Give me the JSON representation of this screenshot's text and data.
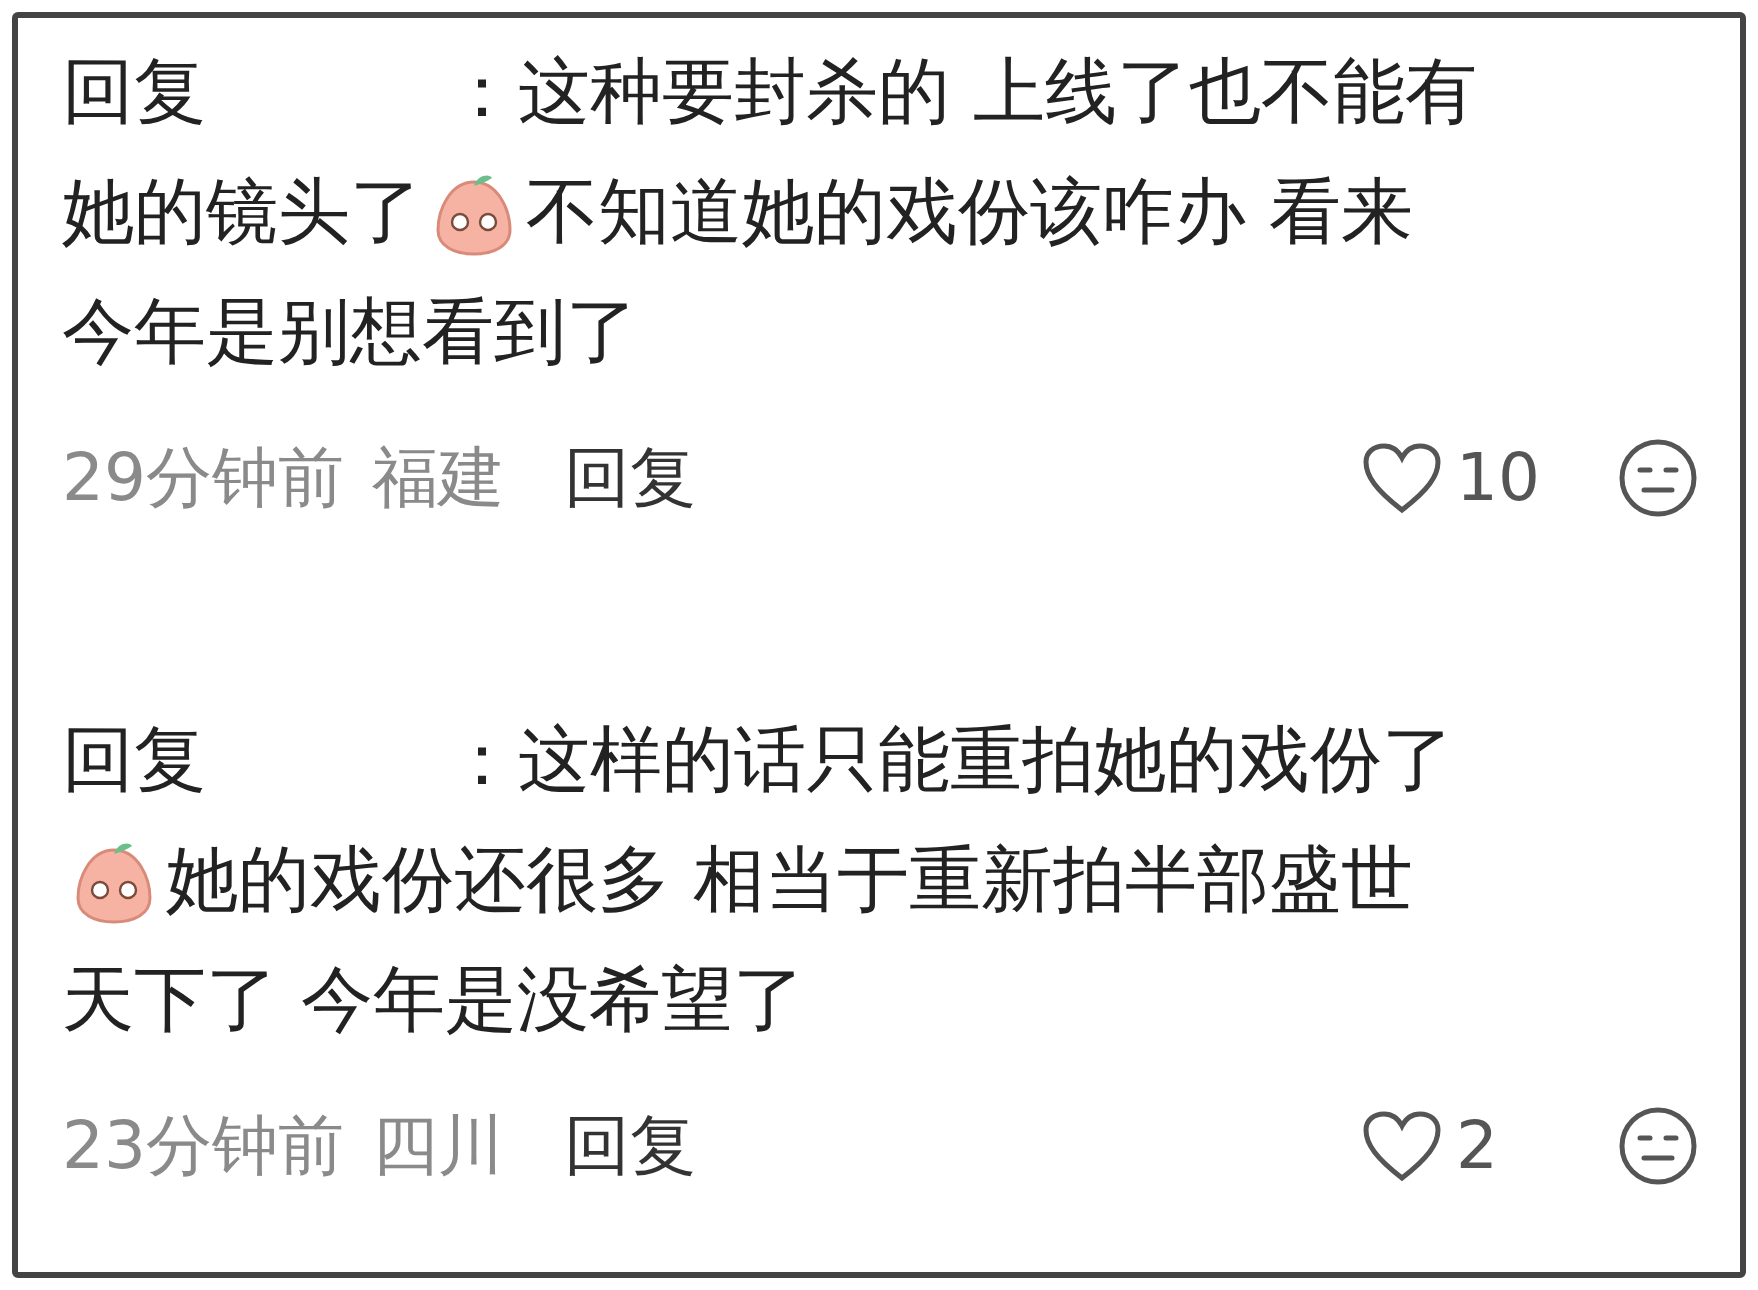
{
  "comments": [
    {
      "lines": [
        [
          {
            "kind": "label",
            "text": "回复"
          },
          {
            "kind": "text",
            "text": "：这种要封杀的 上线了也不能有"
          }
        ],
        [
          {
            "kind": "text",
            "text": "她的镜头了"
          },
          {
            "kind": "emoji"
          },
          {
            "kind": "text",
            "text": "不知道她的戏份该咋办 看来"
          }
        ],
        [
          {
            "kind": "text",
            "text": "今年是别想看到了"
          }
        ]
      ],
      "time": "29分钟前",
      "location": "福建",
      "reply_button": "回复",
      "likes": "10"
    },
    {
      "lines": [
        [
          {
            "kind": "label",
            "text": "回复"
          },
          {
            "kind": "text",
            "text": "：这样的话只能重拍她的戏份了"
          }
        ],
        [
          {
            "kind": "emoji"
          },
          {
            "kind": "text",
            "text": "她的戏份还很多 相当于重新拍半部盛世"
          }
        ],
        [
          {
            "kind": "text",
            "text": "天下了 今年是没希望了"
          }
        ]
      ],
      "time": "23分钟前",
      "location": "四川",
      "reply_button": "回复",
      "likes": "2"
    }
  ]
}
